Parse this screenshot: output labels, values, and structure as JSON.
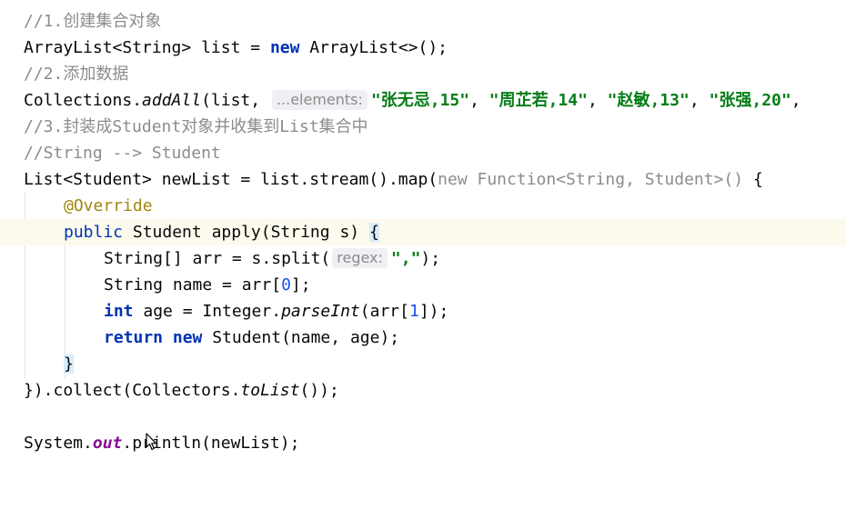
{
  "lines": {
    "l1": {
      "comment": "//1.创建集合对象"
    },
    "l2": {
      "t1": "ArrayList<String> list = ",
      "kw": "new",
      "t2": " ArrayList<>();"
    },
    "l3": {
      "comment": "//2.添加数据"
    },
    "l4": {
      "t1": "Collections.",
      "method": "addAll",
      "t2": "(list, ",
      "hint": "...elements:",
      "s1": "\"张无忌,15\"",
      "c1": ", ",
      "s2": "\"周芷若,14\"",
      "c2": ", ",
      "s3": "\"赵敏,13\"",
      "c3": ", ",
      "s4": "\"张强,20\"",
      "c4": ","
    },
    "l5": {
      "comment": "//3.封装成Student对象并收集到List集合中"
    },
    "l6": {
      "comment": "//String --> Student"
    },
    "l7": {
      "t1": "List<Student> newList = list.stream().map(",
      "g1": "new",
      "g2": " Function<String, Student>()",
      "t2": " {"
    },
    "l8": {
      "ann": "@Override"
    },
    "l9": {
      "kw": "public",
      "t1": " Student apply(String s) ",
      "brace": "{"
    },
    "l10": {
      "t1": "String[] arr = s.split(",
      "hint": "regex:",
      "str": "\",\"",
      "t2": ");"
    },
    "l11": {
      "t1": "String name = arr[",
      "num": "0",
      "t2": "];"
    },
    "l12": {
      "kw": "int",
      "t1": " age = Integer.",
      "method": "parseInt",
      "t2": "(arr[",
      "num": "1",
      "t3": "]);"
    },
    "l13": {
      "kw1": "return",
      "sp": " ",
      "kw2": "new",
      "t1": " Student(name, age);"
    },
    "l14": {
      "brace": "}"
    },
    "l15": {
      "t1": "}).collect(Collectors.",
      "method": "toList",
      "t2": "());"
    },
    "l17": {
      "t1": "System.",
      "field": "out",
      "t2": ".println(newList);"
    }
  }
}
